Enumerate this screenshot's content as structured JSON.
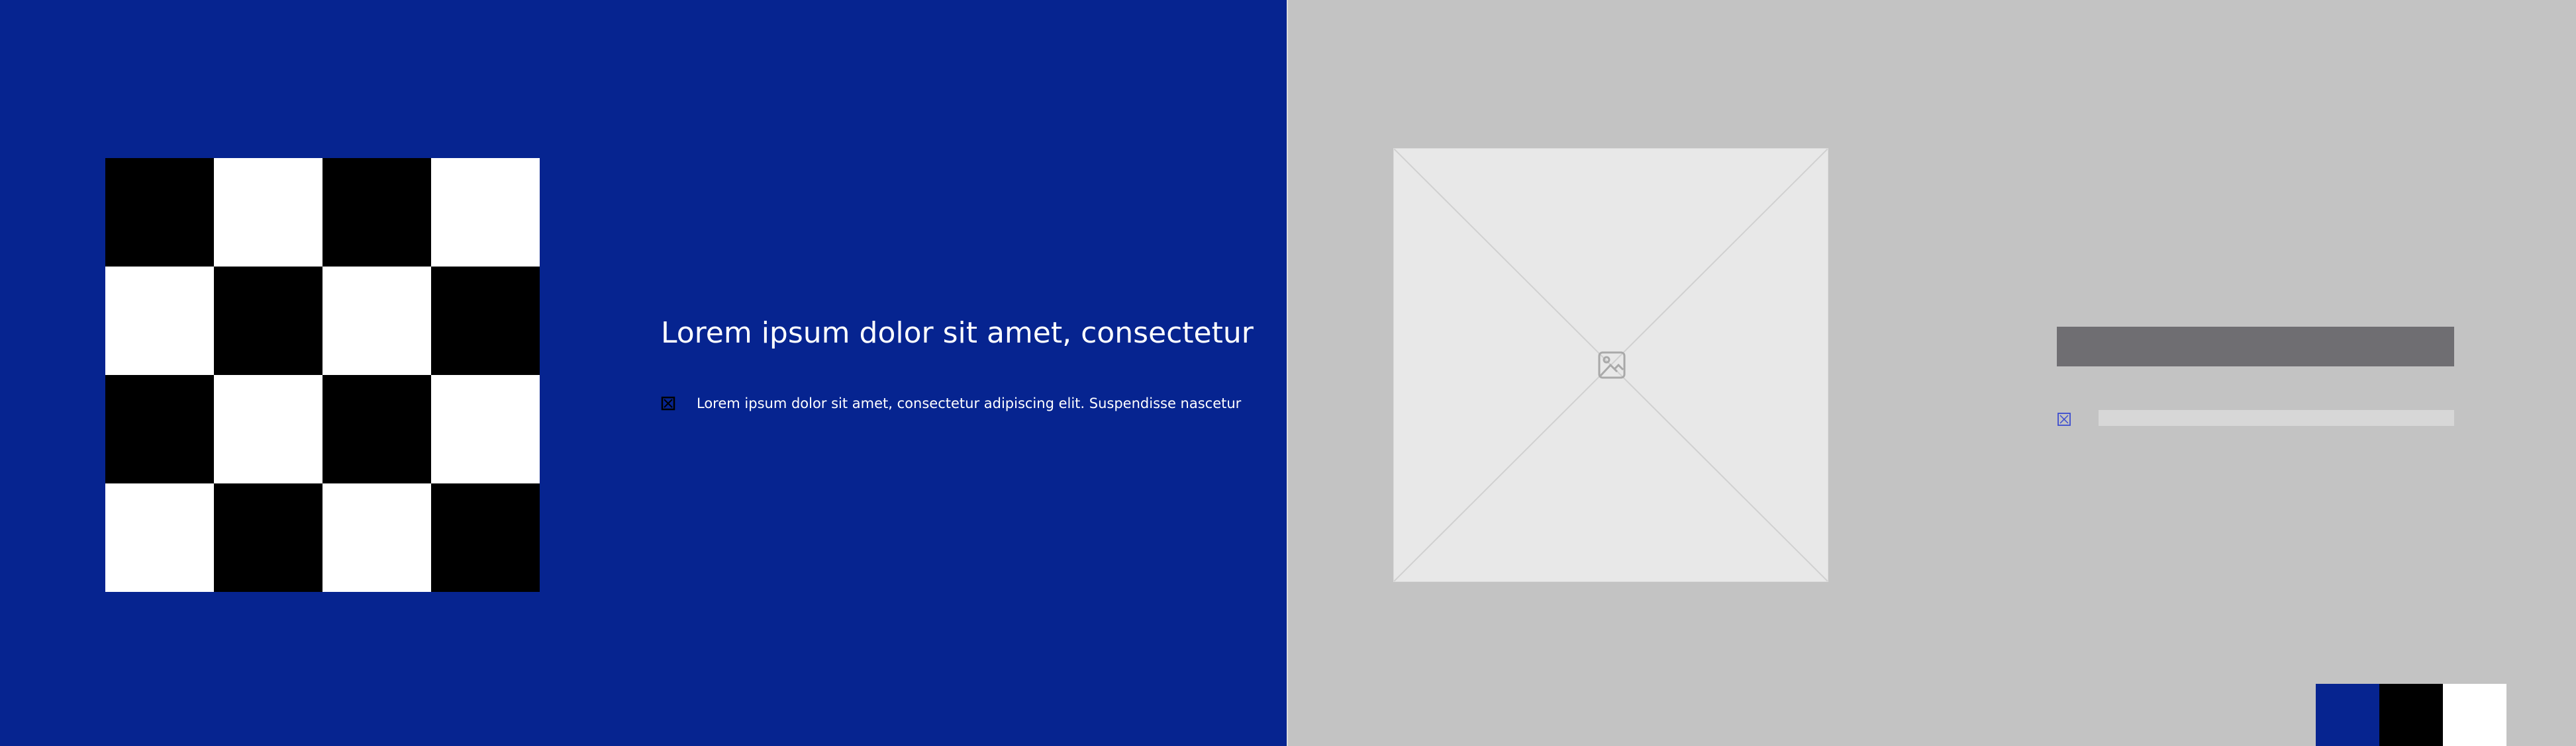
{
  "left_panel": {
    "background": "#062490",
    "checkerboard": {
      "rows": 4,
      "cols": 4,
      "dark_color": "#000000",
      "light_color": "#ffffff"
    },
    "headline": "Lorem ipsum dolor sit amet, consectetur",
    "bullet": {
      "icon": "checkbox-x-icon",
      "text": "Lorem ipsum dolor sit amet, consectetur adipiscing elit. Suspendisse nascetur"
    }
  },
  "right_panel": {
    "background": "#c3c3c3",
    "image_placeholder": {
      "icon": "image-icon"
    },
    "skeleton_title_color": "#6f6e72",
    "skeleton_bullet_icon": "checkbox-x-icon",
    "skeleton_line_color": "#d7d7d7",
    "color_swatches": [
      "#062490",
      "#000000",
      "#ffffff"
    ]
  }
}
